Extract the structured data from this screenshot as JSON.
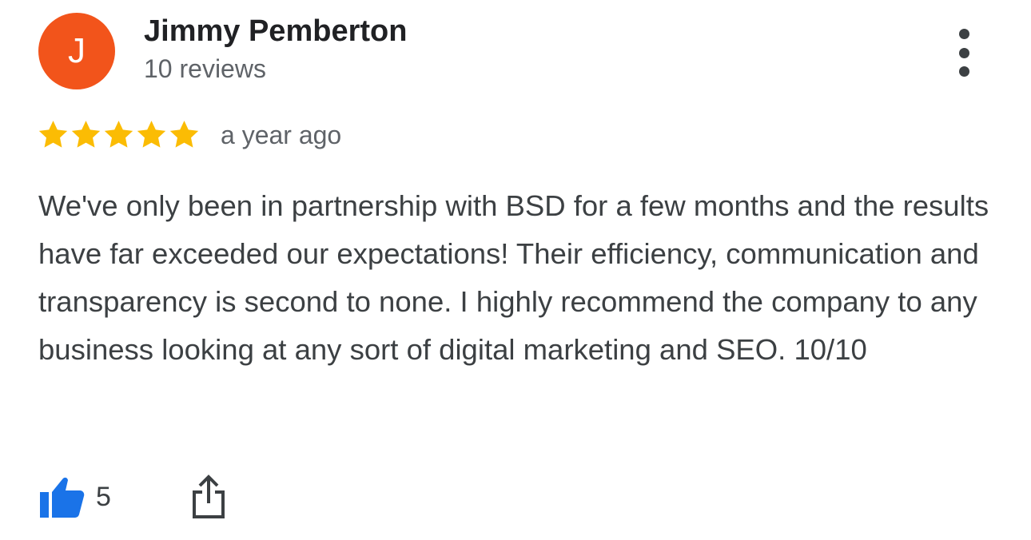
{
  "reviewer": {
    "avatar_letter": "J",
    "avatar_color": "#f2541b",
    "name": "Jimmy Pemberton",
    "review_count": "10 reviews"
  },
  "menu": {
    "icon": "more-vertical-icon"
  },
  "rating": {
    "stars": 5,
    "max_stars": 5,
    "star_color": "#fbbc04",
    "time": "a year ago"
  },
  "review": {
    "text": "We've only been in partnership with BSD for a few months and the results have far exceeded our expectations! Their efficiency, communication and transparency is second to none. I highly recommend the company to any business looking at any sort of digital marketing and SEO. 10/10"
  },
  "actions": {
    "like_icon": "thumbs-up-icon",
    "like_color": "#1a73e8",
    "like_count": "5",
    "share_icon": "share-icon"
  }
}
